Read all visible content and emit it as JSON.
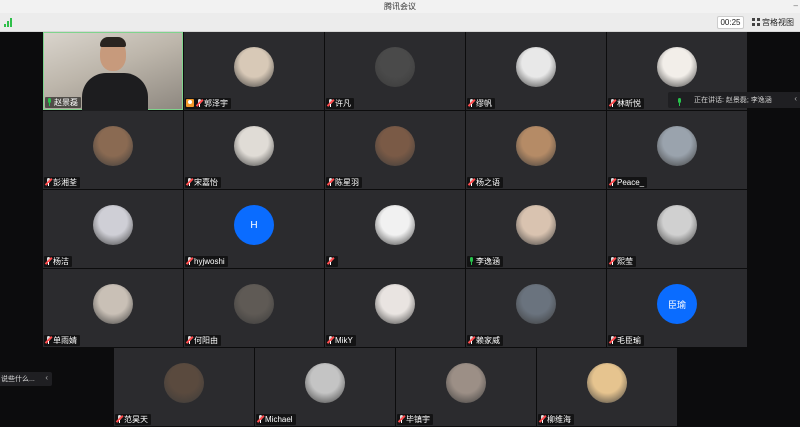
{
  "window": {
    "title": "腾讯会议",
    "ctrl": "–",
    "signal_color": "#2fbf4a"
  },
  "toolbar": {
    "timer": "00:25",
    "view_label": "宫格视图",
    "view_icon": "grid-icon"
  },
  "active_speaker": {
    "label": "正在讲话: 赵景磊; 李逸涵",
    "icon": "mic-icon"
  },
  "chat_preview": {
    "text": "说些什么..."
  },
  "participants": [
    {
      "name": "赵景磊",
      "mic": "on",
      "video": true
    },
    {
      "name": "郭泽宇",
      "mic": "off",
      "host": true
    },
    {
      "name": "许凡",
      "mic": "off"
    },
    {
      "name": "缪帆",
      "mic": "off"
    },
    {
      "name": "林昕悦",
      "mic": "off"
    },
    {
      "name": "彭湘荃",
      "mic": "off"
    },
    {
      "name": "宋嘉怡",
      "mic": "off"
    },
    {
      "name": "陈星羽",
      "mic": "off"
    },
    {
      "name": "杨之语",
      "mic": "off"
    },
    {
      "name": "Peace_",
      "mic": "off"
    },
    {
      "name": "杨洁",
      "mic": "off"
    },
    {
      "name": "hyjwoshi",
      "mic": "off",
      "initial": "H"
    },
    {
      "name": "",
      "mic": "off"
    },
    {
      "name": "李逸涵",
      "mic": "on"
    },
    {
      "name": "熙莹",
      "mic": "off"
    },
    {
      "name": "单雨婧",
      "mic": "off"
    },
    {
      "name": "何阳由",
      "mic": "off"
    },
    {
      "name": "MikY",
      "mic": "off"
    },
    {
      "name": "赖家威",
      "mic": "off"
    },
    {
      "name": "毛臣瑜",
      "mic": "off",
      "initial": "臣瑜"
    },
    {
      "name": "范昊天",
      "mic": "off"
    },
    {
      "name": "Michael",
      "mic": "off"
    },
    {
      "name": "毕镇宇",
      "mic": "off"
    },
    {
      "name": "柳维海",
      "mic": "off"
    }
  ],
  "avatar_colors": [
    "#d8c9b7",
    "#4a4a4a",
    "#e8e8e8",
    "#f2eee9",
    "#8a6a52",
    "#e0dcd6",
    "#7a5a46",
    "#b58b66",
    "#9aa3ad",
    "#cfcfd6",
    "#0a6cff",
    "#f1f1f1",
    "#d9c3b0",
    "#d0d0d0",
    "#c9c0b6",
    "#5f5a55",
    "#e9e4e1",
    "#6a737e",
    "#0a6cff",
    "#5a4a3e",
    "#c4c4c4",
    "#9c8f86",
    "#e6c48f"
  ]
}
